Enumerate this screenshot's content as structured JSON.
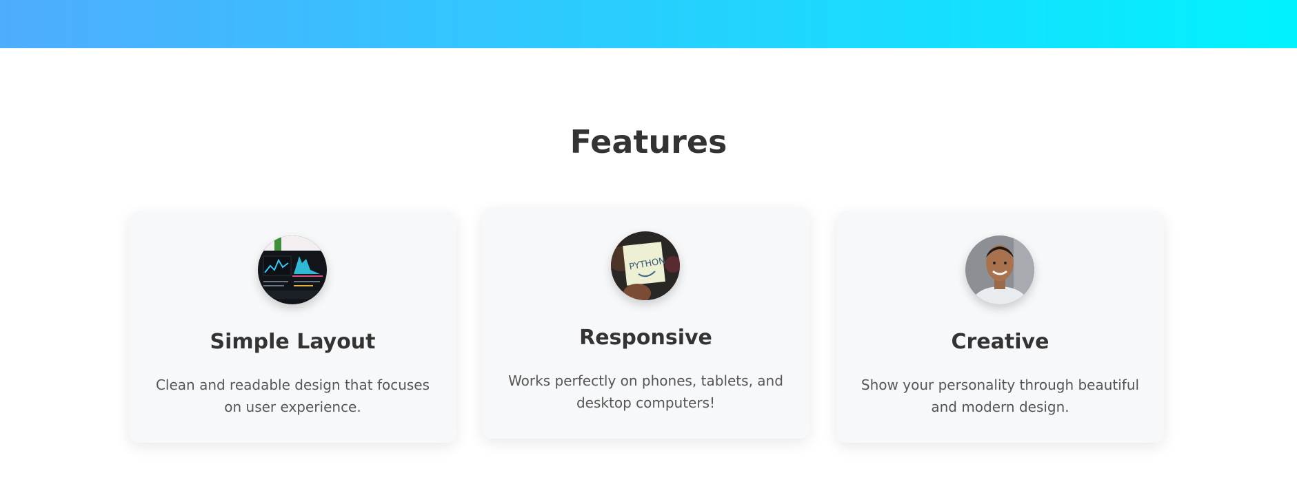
{
  "header": {
    "gradient_start": "#4facfe",
    "gradient_end": "#00f2fe"
  },
  "features": {
    "title": "Features",
    "cards": [
      {
        "title": "Simple Layout",
        "description": "Clean and readable design that focuses on user experience.",
        "image": "analytics-dashboard-photo"
      },
      {
        "title": "Responsive",
        "description": "Works perfectly on phones, tablets, and desktop computers!",
        "image": "python-sticky-note-photo"
      },
      {
        "title": "Creative",
        "description": "Show your personality through beautiful and modern design.",
        "image": "smiling-person-portrait-photo"
      }
    ]
  }
}
